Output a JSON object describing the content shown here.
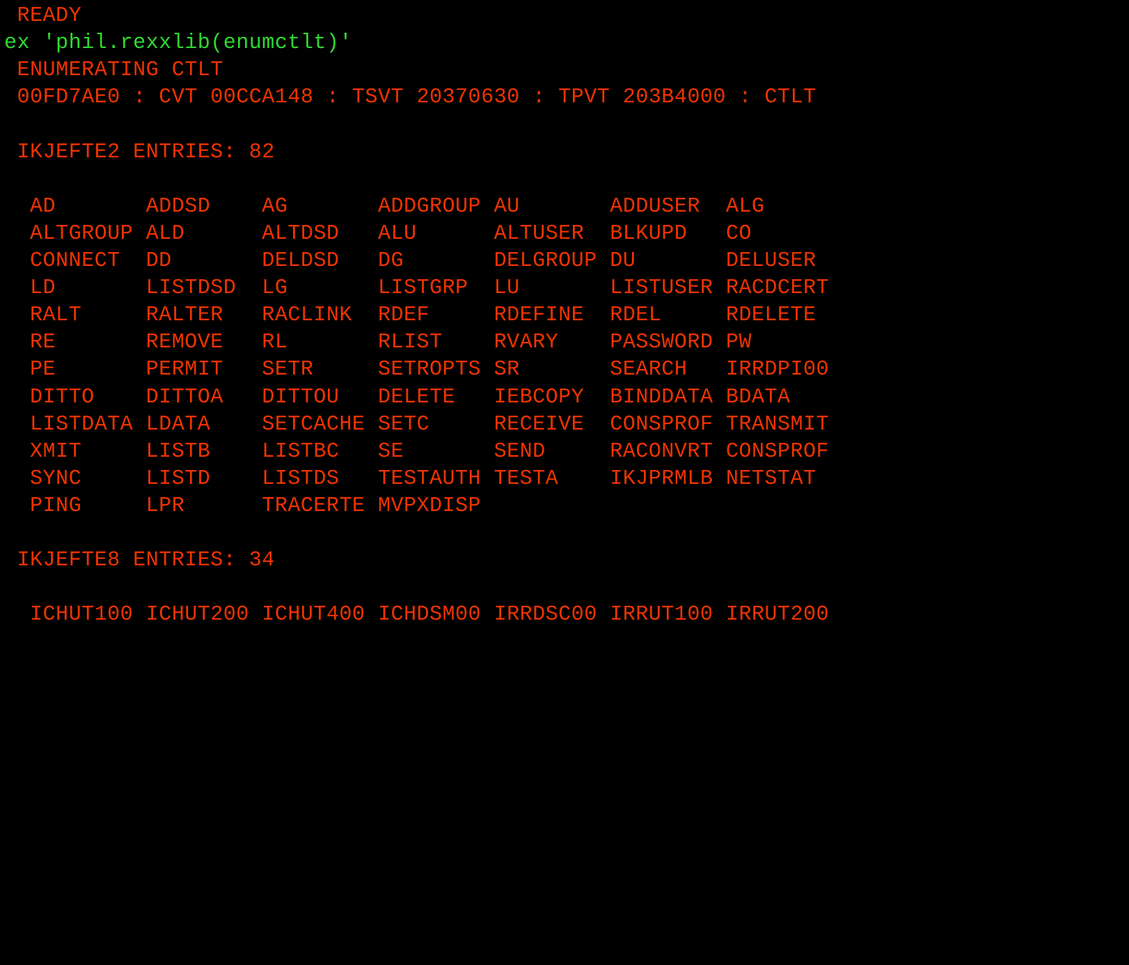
{
  "lines": [
    {
      "indent": 1,
      "cls": "red",
      "text": "READY"
    },
    {
      "indent": 0,
      "cls": "green",
      "text": "ex 'phil.rexxlib(enumctlt)'"
    },
    {
      "indent": 1,
      "cls": "red",
      "text": "ENUMERATING CTLT"
    },
    {
      "indent": 1,
      "cls": "red",
      "text": "00FD7AE0 : CVT 00CCA148 : TSVT 20370630 : TPVT 203B4000 : CTLT"
    },
    {
      "indent": 0,
      "cls": "red",
      "text": ""
    },
    {
      "indent": 1,
      "cls": "red",
      "text": "IKJEFTE2 ENTRIES: 82"
    },
    {
      "indent": 0,
      "cls": "red",
      "text": ""
    },
    {
      "indent": 2,
      "cls": "red",
      "text": "AD       ADDSD    AG       ADDGROUP AU       ADDUSER  ALG"
    },
    {
      "indent": 2,
      "cls": "red",
      "text": "ALTGROUP ALD      ALTDSD   ALU      ALTUSER  BLKUPD   CO"
    },
    {
      "indent": 2,
      "cls": "red",
      "text": "CONNECT  DD       DELDSD   DG       DELGROUP DU       DELUSER"
    },
    {
      "indent": 2,
      "cls": "red",
      "text": "LD       LISTDSD  LG       LISTGRP  LU       LISTUSER RACDCERT"
    },
    {
      "indent": 2,
      "cls": "red",
      "text": "RALT     RALTER   RACLINK  RDEF     RDEFINE  RDEL     RDELETE"
    },
    {
      "indent": 2,
      "cls": "red",
      "text": "RE       REMOVE   RL       RLIST    RVARY    PASSWORD PW"
    },
    {
      "indent": 2,
      "cls": "red",
      "text": "PE       PERMIT   SETR     SETROPTS SR       SEARCH   IRRDPI00"
    },
    {
      "indent": 2,
      "cls": "red",
      "text": "DITTO    DITTOA   DITTOU   DELETE   IEBCOPY  BINDDATA BDATA"
    },
    {
      "indent": 2,
      "cls": "red",
      "text": "LISTDATA LDATA    SETCACHE SETC     RECEIVE  CONSPROF TRANSMIT"
    },
    {
      "indent": 2,
      "cls": "red",
      "text": "XMIT     LISTB    LISTBC   SE       SEND     RACONVRT CONSPROF"
    },
    {
      "indent": 2,
      "cls": "red",
      "text": "SYNC     LISTD    LISTDS   TESTAUTH TESTA    IKJPRMLB NETSTAT"
    },
    {
      "indent": 2,
      "cls": "red",
      "text": "PING     LPR      TRACERTE MVPXDISP"
    },
    {
      "indent": 0,
      "cls": "red",
      "text": ""
    },
    {
      "indent": 1,
      "cls": "red",
      "text": "IKJEFTE8 ENTRIES: 34"
    },
    {
      "indent": 0,
      "cls": "red",
      "text": ""
    },
    {
      "indent": 2,
      "cls": "red",
      "text": "ICHUT100 ICHUT200 ICHUT400 ICHDSM00 IRRDSC00 IRRUT100 IRRUT200"
    }
  ]
}
